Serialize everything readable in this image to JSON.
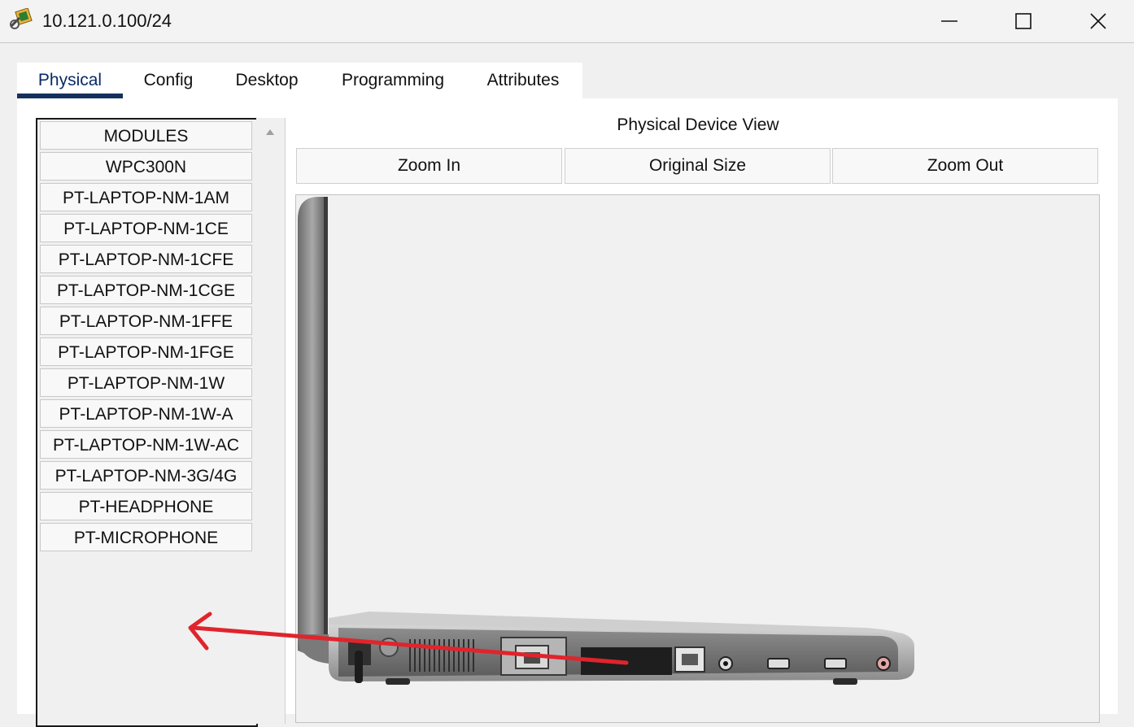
{
  "window": {
    "title": "10.121.0.100/24",
    "icon": "packet-tracer-icon",
    "controls": [
      "minimize-icon",
      "maximize-icon",
      "close-icon"
    ]
  },
  "tabs": [
    {
      "label": "Physical",
      "active": true
    },
    {
      "label": "Config",
      "active": false
    },
    {
      "label": "Desktop",
      "active": false
    },
    {
      "label": "Programming",
      "active": false
    },
    {
      "label": "Attributes",
      "active": false
    }
  ],
  "modules": {
    "header": "MODULES",
    "items": [
      "WPC300N",
      "PT-LAPTOP-NM-1AM",
      "PT-LAPTOP-NM-1CE",
      "PT-LAPTOP-NM-1CFE",
      "PT-LAPTOP-NM-1CGE",
      "PT-LAPTOP-NM-1FFE",
      "PT-LAPTOP-NM-1FGE",
      "PT-LAPTOP-NM-1W",
      "PT-LAPTOP-NM-1W-A",
      "PT-LAPTOP-NM-1W-AC",
      "PT-LAPTOP-NM-3G/4G",
      "PT-HEADPHONE",
      "PT-MICROPHONE"
    ]
  },
  "device_view": {
    "title": "Physical Device View",
    "zoom_in": "Zoom In",
    "original_size": "Original Size",
    "zoom_out": "Zoom Out"
  },
  "colors": {
    "active_tab_underline": "#14315c",
    "annotation_arrow": "#e0242c"
  }
}
